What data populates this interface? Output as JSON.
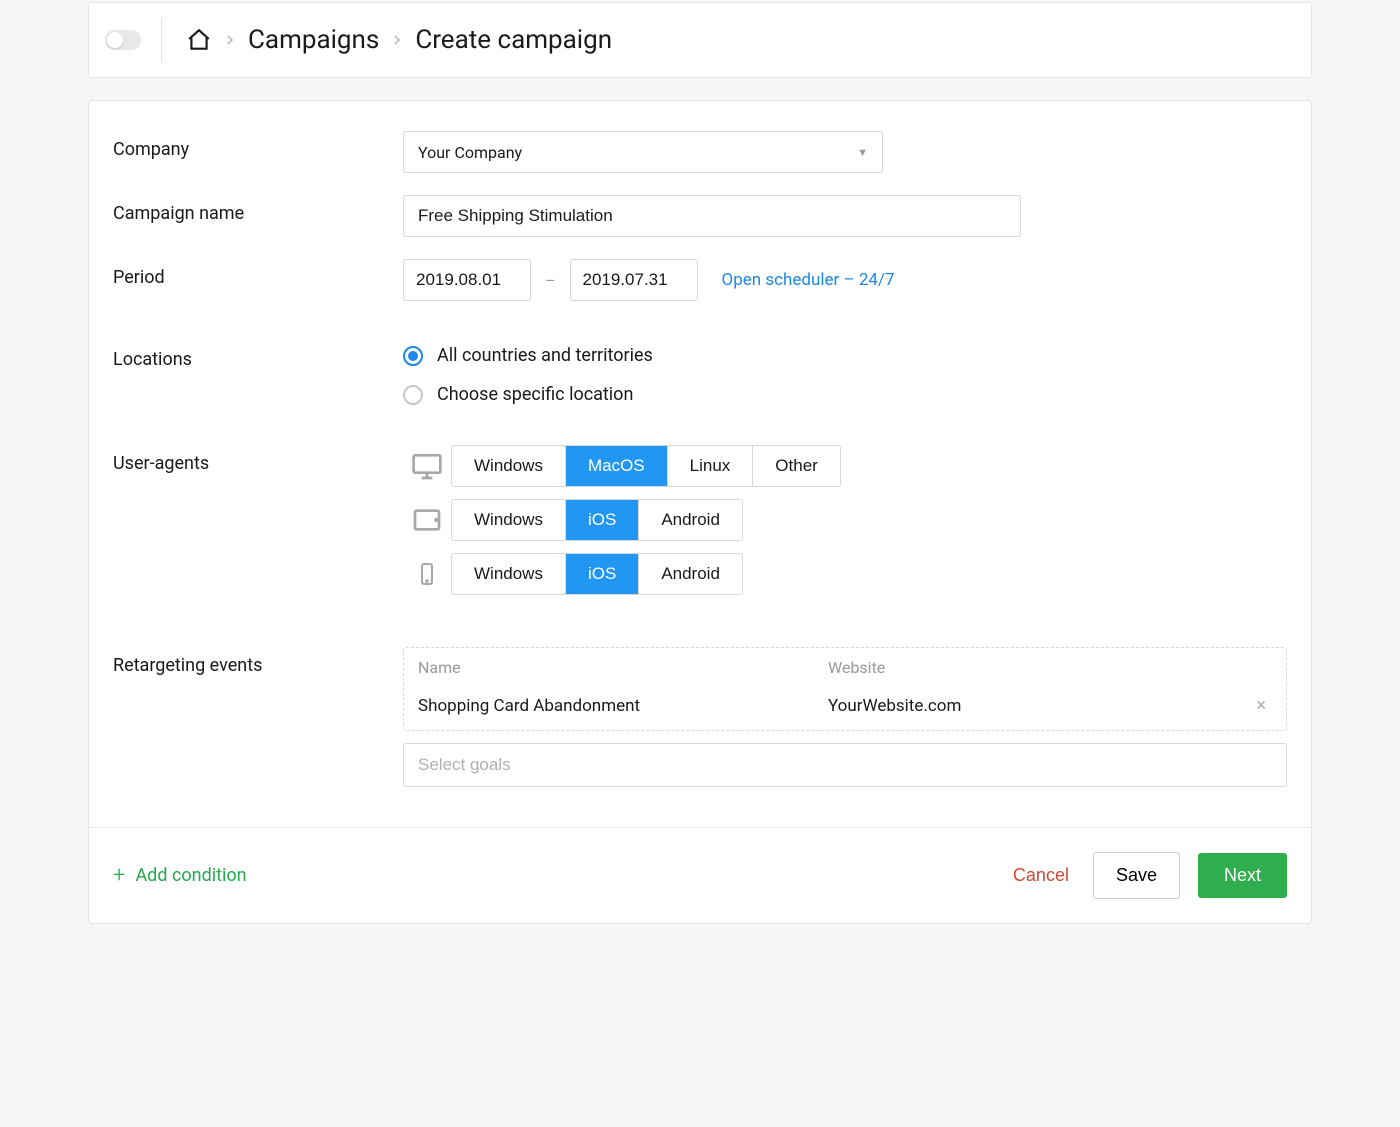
{
  "breadcrumb": {
    "campaigns": "Campaigns",
    "current": "Create campaign"
  },
  "form": {
    "company_label": "Company",
    "company_value": "Your Company",
    "campaign_name_label": "Campaign name",
    "campaign_name_value": "Free Shipping Stimulation",
    "period_label": "Period",
    "period_from": "2019.08.01",
    "period_to": "2019.07.31",
    "scheduler_link": "Open scheduler – 24/7",
    "locations_label": "Locations",
    "locations_all": "All countries and territories",
    "locations_specific": "Choose specific location",
    "user_agents_label": "User-agents",
    "ua": {
      "desktop": {
        "options": [
          "Windows",
          "MacOS",
          "Linux",
          "Other"
        ],
        "selected": "MacOS"
      },
      "tablet": {
        "options": [
          "Windows",
          "iOS",
          "Android"
        ],
        "selected": "iOS"
      },
      "mobile": {
        "options": [
          "Windows",
          "iOS",
          "Android"
        ],
        "selected": "iOS"
      }
    },
    "retargeting_label": "Retargeting events",
    "events": {
      "headers": {
        "name": "Name",
        "website": "Website"
      },
      "rows": [
        {
          "name": "Shopping Card Abandonment",
          "website": "YourWebsite.com"
        }
      ],
      "goals_placeholder": "Select goals"
    }
  },
  "footer": {
    "add_condition": "Add condition",
    "cancel": "Cancel",
    "save": "Save",
    "next": "Next"
  }
}
